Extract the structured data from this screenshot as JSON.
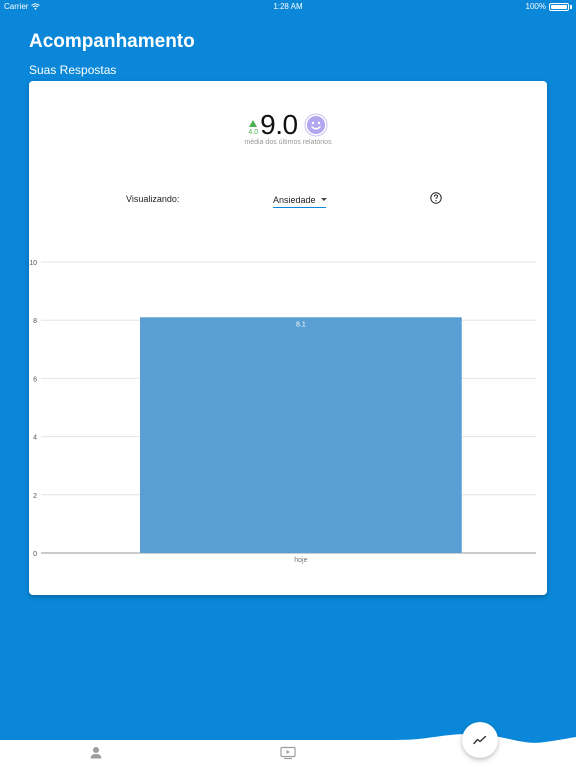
{
  "status_bar": {
    "carrier": "Carrier",
    "time": "1:28 AM",
    "battery": "100%"
  },
  "header": {
    "title": "Acompanhamento",
    "subtitle": "Suas Respostas"
  },
  "summary": {
    "delta": "4.0",
    "score": "9.0",
    "caption": "média dos últimos relatórios",
    "mood_icon": "smiley-face-icon"
  },
  "filter": {
    "label": "Visualizando:",
    "selected": "Ansiedade",
    "help_icon": "help-circle-icon"
  },
  "colors": {
    "background": "#0a87d8",
    "bar": "#5a9fd4",
    "delta": "#4caf50",
    "smiley": "#b3a6ee"
  },
  "chart_data": {
    "type": "bar",
    "categories": [
      "hoje"
    ],
    "values": [
      8.1
    ],
    "data_labels": [
      "8.1"
    ],
    "yticks": [
      "0",
      "2",
      "4",
      "6",
      "8",
      "10"
    ],
    "ylim": [
      0,
      10
    ],
    "grid": true
  },
  "tab_bar": {
    "items": [
      {
        "icon": "person-icon"
      },
      {
        "icon": "video-icon"
      }
    ],
    "fab_icon": "trend-line-icon"
  }
}
